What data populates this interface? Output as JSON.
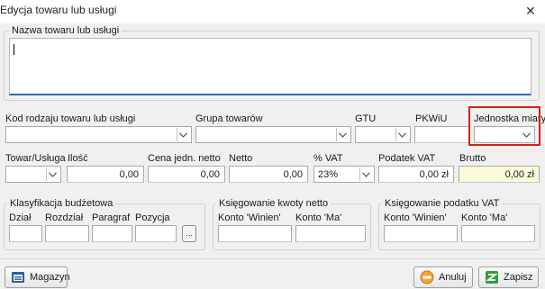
{
  "window": {
    "title": "Edycja towaru lub usługi",
    "close_glyph": "✕"
  },
  "name_section": {
    "legend": "Nazwa towaru lub usługi",
    "value": ""
  },
  "row1": {
    "kod_label": "Kod rodzaju towaru lub usługi",
    "grupa_label": "Grupa towarów",
    "gtu_label": "GTU",
    "pkwiu_label": "PKWiU",
    "jednostka_label": "Jednostka miary",
    "kod_value": "",
    "grupa_value": "",
    "gtu_value": "",
    "pkwiu_value": "",
    "jednostka_value": ""
  },
  "row2": {
    "typ_label": "Towar/Usługa",
    "typ_value": "",
    "ilosc_label": "Ilość",
    "ilosc_value": "0,00",
    "cena_label": "Cena jedn. netto",
    "cena_value": "0,00",
    "netto_label": "Netto",
    "netto_value": "0,00",
    "vat_label": "% VAT",
    "vat_value": "23%",
    "podatek_label": "Podatek VAT",
    "podatek_value": "0,00 zł",
    "brutto_label": "Brutto",
    "brutto_value": "0,00 zł"
  },
  "budget": {
    "legend": "Klasyfikacja budżetowa",
    "dzial_label": "Dział",
    "rozdzial_label": "Rozdział",
    "paragraf_label": "Paragraf",
    "pozycja_label": "Pozycja",
    "browse_label": "..."
  },
  "ksiegowanie_netto": {
    "legend": "Księgowanie kwoty netto",
    "winien_label": "Konto 'Winien'",
    "ma_label": "Konto 'Ma'"
  },
  "ksiegowanie_vat": {
    "legend": "Księgowanie podatku VAT",
    "winien_label": "Konto 'Winien'",
    "ma_label": "Konto 'Ma'"
  },
  "buttons": {
    "magazyn": "Magazyn",
    "anuluj": "Anuluj",
    "zapisz": "Zapisz"
  },
  "colors": {
    "highlight_red": "#d9211f",
    "name_underline": "#2a6bbf",
    "brutto_bg": "#fbfbdc"
  }
}
